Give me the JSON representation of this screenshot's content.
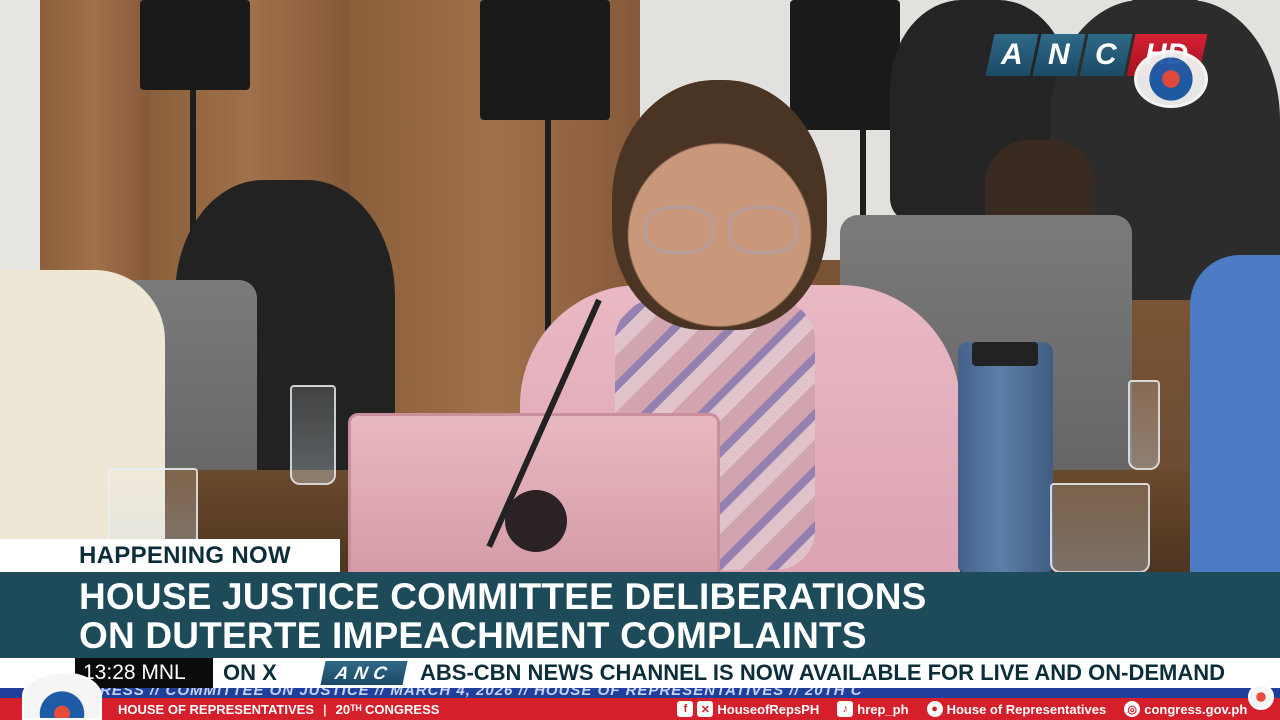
{
  "broadcast": {
    "channel_bug": {
      "letters": [
        "A",
        "N",
        "C"
      ],
      "hd": "HD"
    },
    "lower_third": {
      "tag": "HAPPENING NOW",
      "headline_line1": "HOUSE JUSTICE COMMITTEE DELIBERATIONS",
      "headline_line2": "ON DUTERTE IMPEACHMENT COMPLAINTS"
    },
    "ticker": {
      "clock": "13:28 MNL",
      "lead": "ON X",
      "logo": "ANC",
      "text": "ABS-CBN NEWS CHANNEL IS NOW AVAILABLE FOR LIVE AND ON-DEMAND"
    },
    "house_strip": {
      "text": "RESS // COMMITTEE ON JUSTICE // MARCH 4, 2026 // HOUSE OF REPRESENTATIVES // 20TH C"
    },
    "house_footer": {
      "org": "HOUSE OF REPRESENTATIVES",
      "congress": "20ᵀᴴ CONGRESS",
      "social_handle": "HouseofRepsPH",
      "tiktok": "hrep_ph",
      "facebook_page": "House of Representatives",
      "website": "congress.gov.ph"
    },
    "colors": {
      "headline_bg": "#1d4b5a",
      "footer_red": "#d51f2b",
      "strip_blue": "#203f9c",
      "hd_red": "#d62034"
    }
  }
}
